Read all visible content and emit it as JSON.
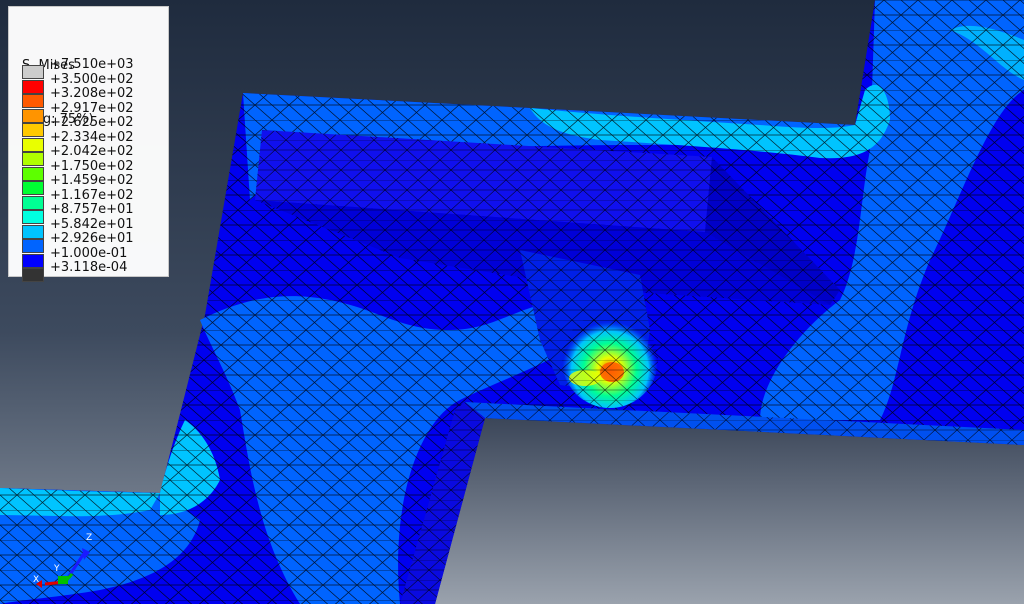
{
  "legend": {
    "variable": "S, Mises",
    "averaging": "(Avg: 75%)",
    "entries": [
      {
        "label": "+7.510e+03",
        "color": "#cccccc"
      },
      {
        "label": "+3.500e+02",
        "color": "#ff0000"
      },
      {
        "label": "+3.208e+02",
        "color": "#ff5a00"
      },
      {
        "label": "+2.917e+02",
        "color": "#ff9400"
      },
      {
        "label": "+2.625e+02",
        "color": "#ffc900"
      },
      {
        "label": "+2.334e+02",
        "color": "#e9ff00"
      },
      {
        "label": "+2.042e+02",
        "color": "#b0ff00"
      },
      {
        "label": "+1.750e+02",
        "color": "#5dff00"
      },
      {
        "label": "+1.459e+02",
        "color": "#00ff33"
      },
      {
        "label": "+1.167e+02",
        "color": "#00ff94"
      },
      {
        "label": "+8.757e+01",
        "color": "#00ffe0"
      },
      {
        "label": "+5.842e+01",
        "color": "#00c4ff"
      },
      {
        "label": "+2.926e+01",
        "color": "#0064ff"
      },
      {
        "label": "+1.000e-01",
        "color": "#0000ff"
      },
      {
        "label": "+3.118e-04",
        "color": "#333333"
      }
    ]
  },
  "triad": {
    "x_label": "X",
    "y_label": "Y",
    "z_label": "Z"
  },
  "colors": {
    "background_top": "#1f2b3e",
    "background_bottom": "#8e97a4",
    "low_stress": "#0000ff",
    "moderate_stress": "#0064ff",
    "elevated_stress": "#00c4ff",
    "mesh_line": "#000000"
  }
}
